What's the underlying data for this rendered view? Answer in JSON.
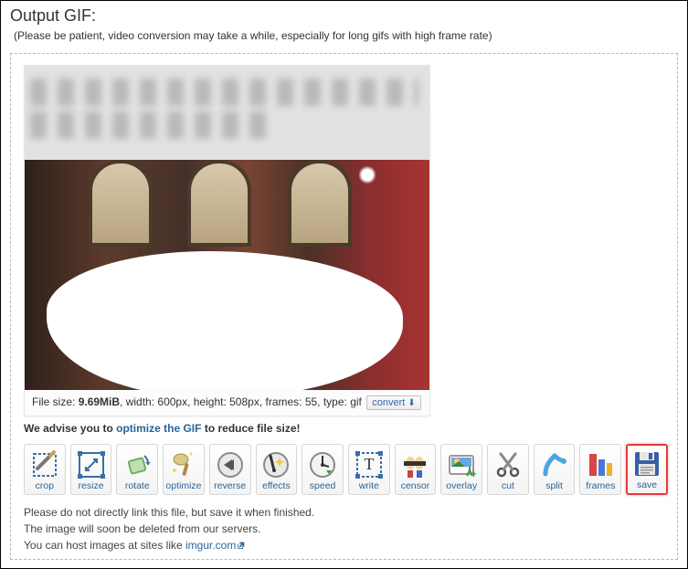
{
  "header": {
    "title": "Output GIF:",
    "subtitle": "(Please be patient, video conversion may take a while, especially for long gifs with high frame rate)"
  },
  "meta": {
    "size_label": "File size:",
    "size_value": "9.69MiB",
    "rest": ", width: 600px, height: 508px, frames: 55, type: gif",
    "convert_label": "convert"
  },
  "advice": {
    "pre": "We advise you to ",
    "link": "optimize the GIF",
    "post": " to reduce file size!"
  },
  "tools": [
    {
      "key": "crop",
      "label": "crop"
    },
    {
      "key": "resize",
      "label": "resize"
    },
    {
      "key": "rotate",
      "label": "rotate"
    },
    {
      "key": "optimize",
      "label": "optimize"
    },
    {
      "key": "reverse",
      "label": "reverse"
    },
    {
      "key": "effects",
      "label": "effects"
    },
    {
      "key": "speed",
      "label": "speed"
    },
    {
      "key": "write",
      "label": "write"
    },
    {
      "key": "censor",
      "label": "censor"
    },
    {
      "key": "overlay",
      "label": "overlay"
    },
    {
      "key": "cut",
      "label": "cut"
    },
    {
      "key": "split",
      "label": "split"
    },
    {
      "key": "frames",
      "label": "frames"
    },
    {
      "key": "save",
      "label": "save"
    }
  ],
  "highlighted_tool": "save",
  "notes": {
    "line1": "Please do not directly link this file, but save it when finished.",
    "line2": "The image will soon be deleted from our servers.",
    "line3_pre": "You can host images at sites like ",
    "line3_link": "imgur.com"
  }
}
